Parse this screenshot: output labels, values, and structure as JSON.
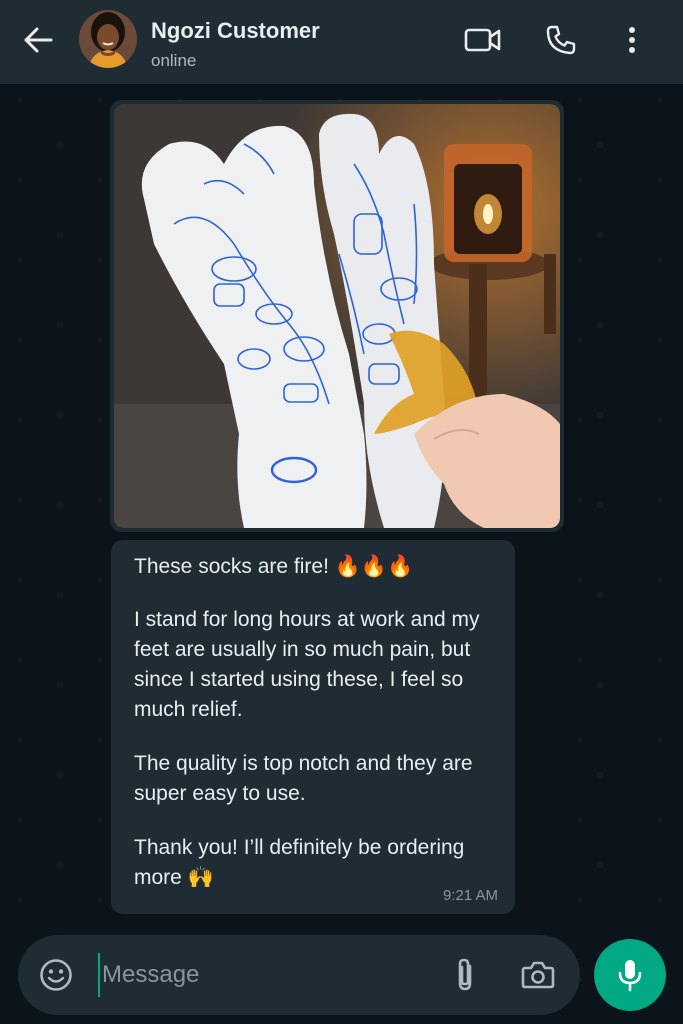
{
  "header": {
    "contact_name": "Ngozi Customer",
    "status": "online",
    "icons": [
      "back-arrow-icon",
      "video-call-icon",
      "phone-icon",
      "more-vert-icon"
    ]
  },
  "messages": {
    "image_caption": "",
    "text_bubble": {
      "paragraphs": [
        "These socks are fire! 🔥🔥🔥",
        "I stand for long hours at work and my feet are usually in so much pain, but since I started using these, I feel so much relief.",
        "The quality is top notch and they are super easy to use.",
        "Thank you! I’ll definitely be ordering more 🙌"
      ],
      "time": "9:21 AM"
    }
  },
  "composer": {
    "placeholder": "Message",
    "icons": [
      "emoji-icon",
      "attach-icon",
      "camera-icon",
      "mic-icon"
    ]
  },
  "colors": {
    "header_bg": "#1f2c34",
    "chat_bg": "#0b141a",
    "bubble_bg": "#1f2c34",
    "accent": "#00a884"
  }
}
